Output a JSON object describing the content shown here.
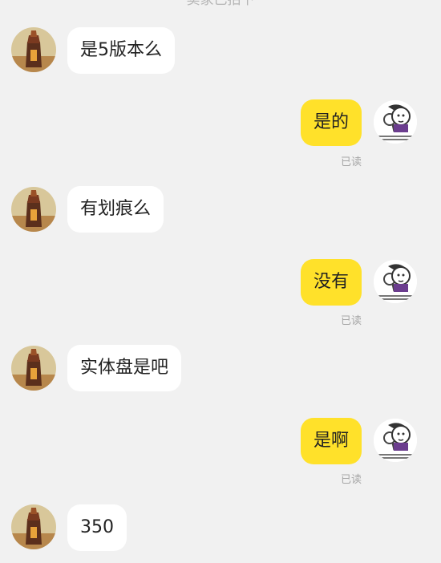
{
  "system_note": "卖家已拍下",
  "messages": [
    {
      "side": "in",
      "text": "是5版本么",
      "avatar_icon": "tower-avatar-icon"
    },
    {
      "side": "out",
      "text": "是的",
      "status": "已读",
      "avatar_icon": "cartoon-face-avatar-icon"
    },
    {
      "side": "in",
      "text": "有划痕么",
      "avatar_icon": "tower-avatar-icon"
    },
    {
      "side": "out",
      "text": "没有",
      "status": "已读",
      "avatar_icon": "cartoon-face-avatar-icon"
    },
    {
      "side": "in",
      "text": "实体盘是吧",
      "avatar_icon": "tower-avatar-icon"
    },
    {
      "side": "out",
      "text": "是啊",
      "status": "已读",
      "avatar_icon": "cartoon-face-avatar-icon"
    },
    {
      "side": "in",
      "text": "350",
      "avatar_icon": "tower-avatar-icon"
    }
  ],
  "colors": {
    "background": "#f1f1f1",
    "incoming_bubble": "#ffffff",
    "outgoing_bubble": "#ffe12a",
    "status_text": "#a6a6a6"
  }
}
